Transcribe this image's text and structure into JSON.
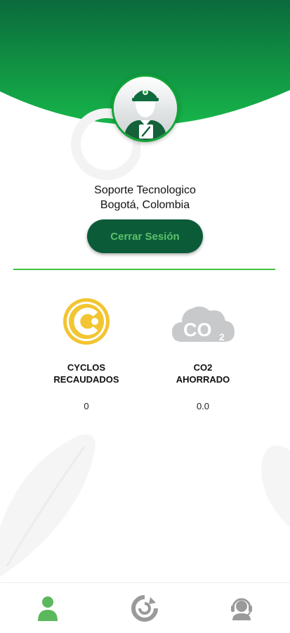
{
  "profile": {
    "name": "Soporte Tecnologico",
    "location": "Bogotá, Colombia",
    "logout_label": "Cerrar Sesión"
  },
  "stats": [
    {
      "label_line1": "CYCLOS",
      "label_line2": "RECAUDADOS",
      "value": "0",
      "icon": "cyclos-coin-icon"
    },
    {
      "label_line1": "CO2",
      "label_line2": "AHORRADO",
      "value": "0.0",
      "icon": "co2-cloud-icon"
    }
  ],
  "co2_icon_text": "CO",
  "co2_icon_sub": "2",
  "nav": {
    "items": [
      {
        "icon": "profile-icon",
        "active": true
      },
      {
        "icon": "recycle-icon",
        "active": false
      },
      {
        "icon": "support-headset-icon",
        "active": false
      }
    ]
  },
  "colors": {
    "header_dark": "#0a6a3c",
    "header_light": "#17b54a",
    "button_bg": "#0b5b39",
    "button_text": "#5cc16b",
    "divider": "#43c23b",
    "coin": "#f2c531",
    "cloud": "#c8c9cb",
    "nav_active": "#5cb85c",
    "nav_inactive": "#9a9a9a"
  }
}
